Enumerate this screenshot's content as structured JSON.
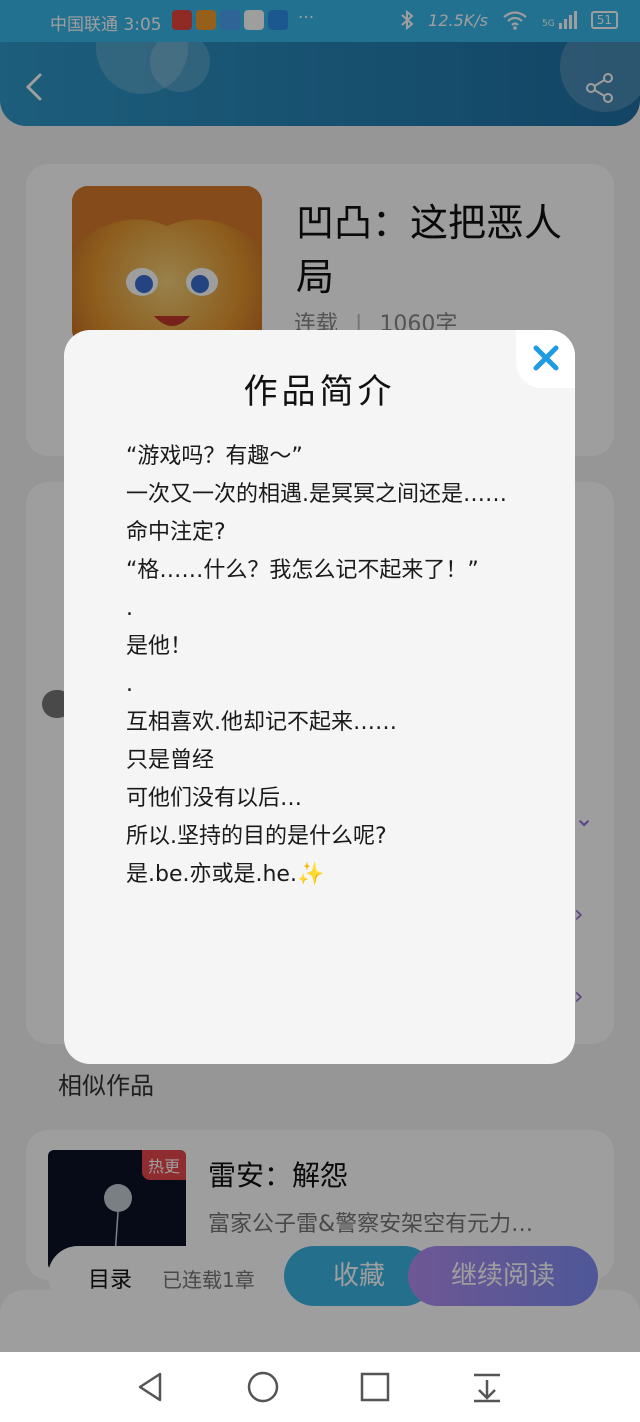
{
  "status_bar": {
    "carrier": "中国联通 3:05",
    "network_speed": "12.5K/s",
    "signal_label": "5G",
    "battery": "51",
    "more": "···"
  },
  "header": {
    "back_icon": "chevron-left-icon",
    "share_icon": "share-icon"
  },
  "book": {
    "title": "凹凸：这把恶人局",
    "status": "连载",
    "word_count": "1060字"
  },
  "modal": {
    "title": "作品简介",
    "close_icon": "close-icon",
    "lines": [
      "“游戏吗？有趣～”",
      "一次又一次的相遇.是冥冥之间还是……",
      "命中注定?",
      "“格……什么？我怎么记不起来了！”",
      ".",
      "是他！",
      ".",
      "互相喜欢.他却记不起来……",
      "只是曾经",
      "可他们没有以后…",
      "所以.坚持的目的是什么呢?",
      "是.be.亦或是.he.✨"
    ]
  },
  "similar": {
    "heading": "相似作品",
    "items": [
      {
        "tag": "热更",
        "title": "雷安：解怨",
        "desc": "富家公子雷&警察安架空有元力…"
      }
    ]
  },
  "action_bar": {
    "toc": "目录",
    "serial": "已连载1章",
    "favorite": "收藏",
    "continue_reading": "继续阅读"
  },
  "colors": {
    "status_bar": "#39b6e8",
    "header": "#2f98c8",
    "close_icon": "#1e9be3",
    "favorite_button": "#3ab3e2",
    "continue_button": "#b28df0",
    "hot_tag": "#e5484d"
  },
  "nav_bar": {
    "icons": [
      "back-triangle-icon",
      "home-circle-icon",
      "recents-square-icon",
      "download-icon"
    ]
  }
}
